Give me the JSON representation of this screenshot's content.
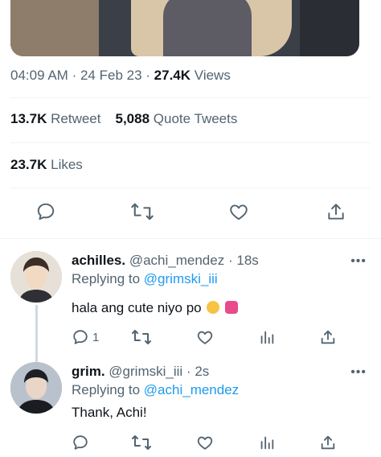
{
  "tweet": {
    "time": "04:09 AM",
    "separator": "·",
    "date": "24 Feb 23",
    "views_count": "27.4K",
    "views_label": "Views",
    "retweets_count": "13.7K",
    "retweets_label": "Retweet",
    "quotes_count": "5,088",
    "quotes_label": "Quote Tweets",
    "likes_count": "23.7K",
    "likes_label": "Likes"
  },
  "replies": [
    {
      "display_name": "achilles.",
      "handle": "@achi_mendez",
      "time": "18s",
      "replying_label": "Replying to",
      "replying_to": "@grimski_iii",
      "text": "hala ang cute niyo po",
      "reply_count": "1",
      "more_label": "•••"
    },
    {
      "display_name": "grim.",
      "handle": "@grimski_iii",
      "time": "2s",
      "replying_label": "Replying to",
      "replying_to": "@achi_mendez",
      "text": "Thank, Achi!",
      "more_label": "•••"
    }
  ],
  "colors": {
    "accent": "#1d9bf0",
    "secondary_text": "#536471",
    "primary_text": "#0f1419",
    "heart_emoji": "#e84a8a",
    "pleading_emoji": "#f6c343"
  },
  "icons": [
    "reply-icon",
    "retweet-icon",
    "like-icon",
    "share-icon",
    "analytics-icon",
    "more-icon"
  ]
}
